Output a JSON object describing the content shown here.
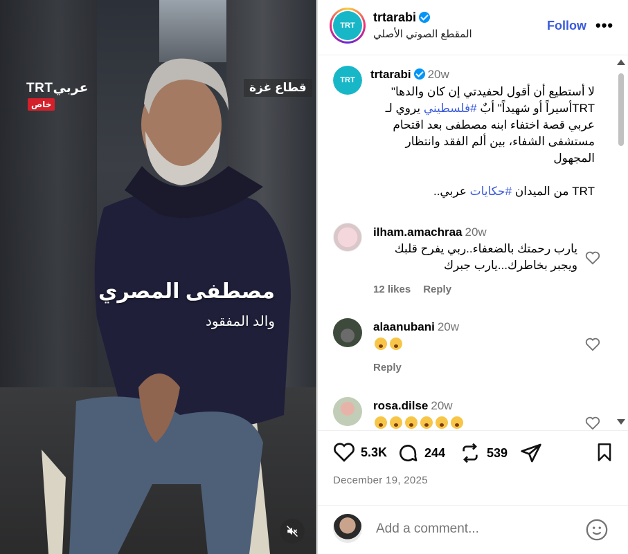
{
  "media": {
    "brand_logo": "TRTعربي",
    "brand_badge": "خاص",
    "location_tag": "قطاع غزة",
    "caption_name": "مصطفى المصري",
    "caption_role": "والد المفقود",
    "mute_icon": "speaker-muted-icon"
  },
  "header": {
    "username": "trtarabi",
    "subtitle": "المقطع الصوتي الأصلي",
    "follow_label": "Follow",
    "more_label": "•••",
    "avatar_text": "TRT"
  },
  "post": {
    "username": "trtarabi",
    "time": "20w",
    "caption_line1": "لا أستطيع أن أقول لحفيدتي إن كان والدها\"",
    "caption_line2_pre": "TRTأسيراً أو شهيداً\" أبٌ ",
    "caption_line2_hashtag": "#فلسطيني",
    "caption_line2_post": " يروي لـ",
    "caption_line3": "عربي قصة اختفاء ابنه مصطفى بعد اقتحام",
    "caption_line4": "مستشفى الشفاء، بين ألم الفقد وانتظار",
    "caption_line5": "المجهول",
    "caption_footer_pre": "TRT من الميدان ",
    "caption_footer_hashtag": "#حكايات",
    "caption_footer_post": " عربي.."
  },
  "comments": [
    {
      "username": "ilham.amachraa",
      "time": "20w",
      "text_line1": "يارب رحمتك بالضعفاء..ربي يفرح قلبك",
      "text_line2": "ويجبر بخاطرك...يارب جبرك",
      "likes": "12 likes",
      "reply": "Reply"
    },
    {
      "username": "alaanubani",
      "time": "20w",
      "emoji_count": 2,
      "reply": "Reply"
    },
    {
      "username": "rosa.dilse",
      "time": "20w",
      "emoji_count": 6
    }
  ],
  "actions": {
    "likes": "5.3K",
    "comments": "244",
    "reposts": "539",
    "date": "December 19, 2025"
  },
  "comment_bar": {
    "placeholder": "Add a comment..."
  },
  "colors": {
    "link": "#3b5bdb",
    "verified": "#0095f6",
    "trt_teal": "#18b7c8",
    "badge_red": "#d3202a"
  }
}
